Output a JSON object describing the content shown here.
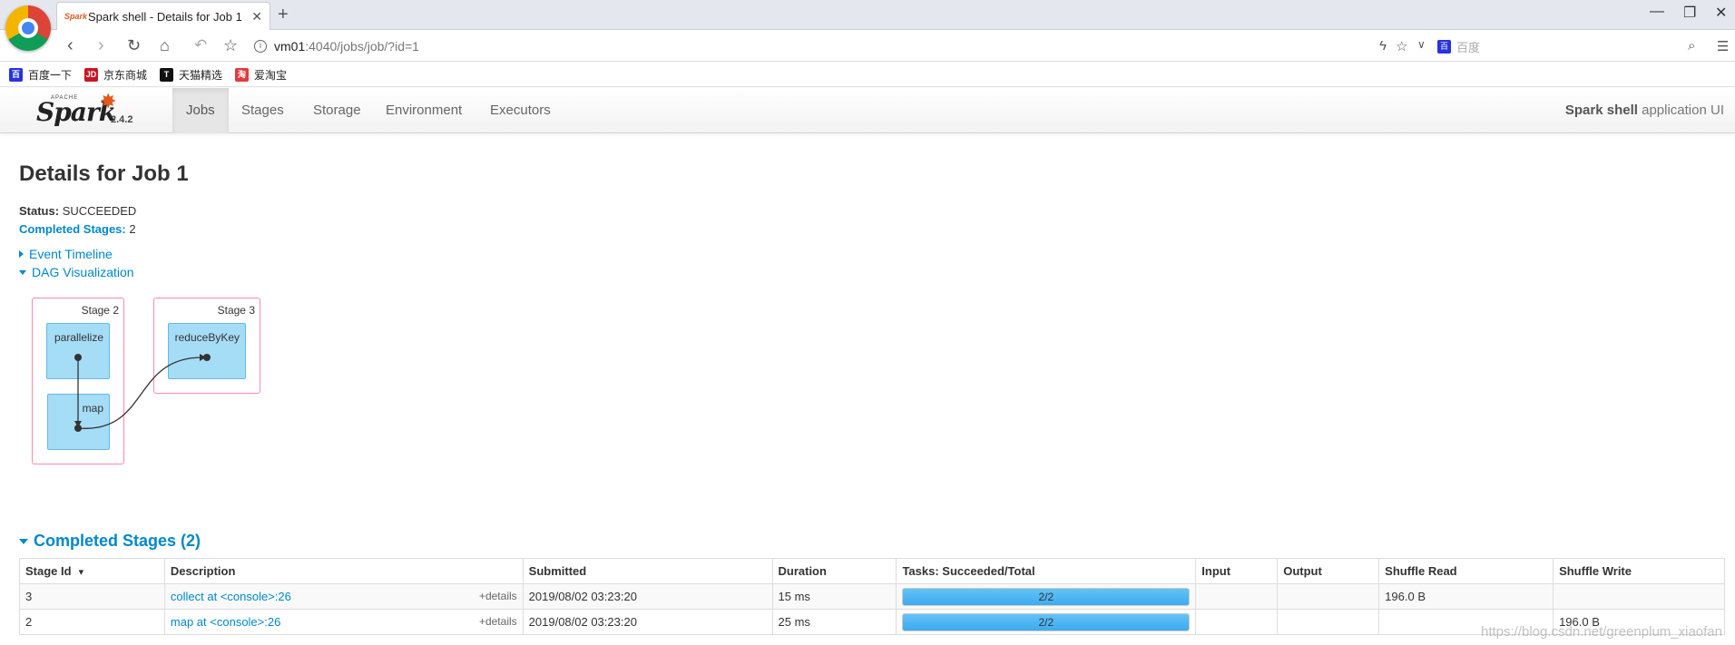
{
  "browser": {
    "tab_title": "Spark shell - Details for Job 1",
    "url_host": "vm01",
    "url_path": ":4040/jobs/job/?id=1",
    "search_placeholder": "百度",
    "bookmarks": [
      {
        "label": "百度一下",
        "icon": "baidu-icon",
        "icon_text": "百",
        "color": "#2932e1"
      },
      {
        "label": "京东商城",
        "icon": "jd-icon",
        "icon_text": "JD",
        "color": "#c91623"
      },
      {
        "label": "天猫精选",
        "icon": "tmall-icon",
        "icon_text": "T",
        "color": "#111111"
      },
      {
        "label": "爱淘宝",
        "icon": "taobao-icon",
        "icon_text": "淘",
        "color": "#e4393c"
      }
    ]
  },
  "spark": {
    "version": "2.4.2",
    "nav": [
      "Jobs",
      "Stages",
      "Storage",
      "Environment",
      "Executors"
    ],
    "active_nav": "Jobs",
    "app_name_bold": "Spark shell",
    "app_name_rest": " application UI"
  },
  "page": {
    "title": "Details for Job 1",
    "status_label": "Status:",
    "status_value": "SUCCEEDED",
    "completed_label": "Completed Stages:",
    "completed_value": "2",
    "event_timeline": "Event Timeline",
    "dag_visualization": "DAG Visualization"
  },
  "dag": {
    "clusters": [
      {
        "label": "Stage 2",
        "nodes": [
          "parallelize",
          "map"
        ]
      },
      {
        "label": "Stage 3",
        "nodes": [
          "reduceByKey"
        ]
      }
    ]
  },
  "stages_table": {
    "title": "Completed Stages (2)",
    "columns": [
      "Stage Id",
      "Description",
      "Submitted",
      "Duration",
      "Tasks: Succeeded/Total",
      "Input",
      "Output",
      "Shuffle Read",
      "Shuffle Write"
    ],
    "sort_indicator": "▾",
    "rows": [
      {
        "id": "3",
        "desc": "collect at <console>:26",
        "details": "+details",
        "submitted": "2019/08/02 03:23:20",
        "duration": "15 ms",
        "tasks": "2/2",
        "tasks_fraction": 1,
        "input": "",
        "output": "",
        "shuffle_read": "196.0 B",
        "shuffle_write": ""
      },
      {
        "id": "2",
        "desc": "map at <console>:26",
        "details": "+details",
        "submitted": "2019/08/02 03:23:20",
        "duration": "25 ms",
        "tasks": "2/2",
        "tasks_fraction": 1,
        "input": "",
        "output": "",
        "shuffle_read": "",
        "shuffle_write": "196.0 B"
      }
    ]
  },
  "watermark": "https://blog.csdn.net/greenplum_xiaofan"
}
